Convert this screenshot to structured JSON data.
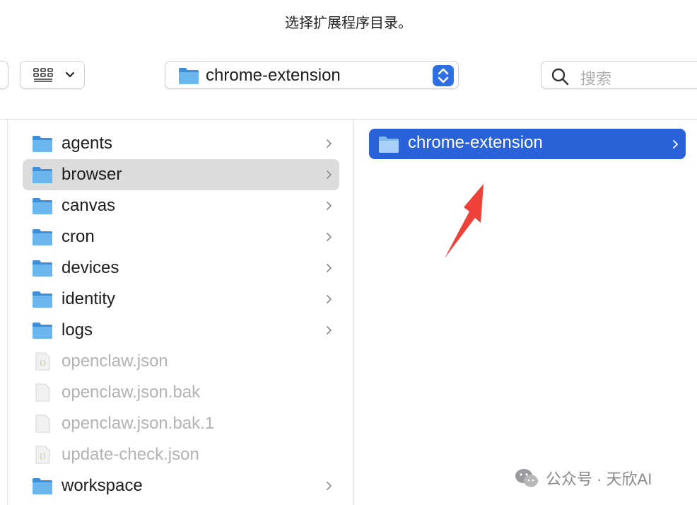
{
  "dialog": {
    "title": "选择扩展程序目录。"
  },
  "toolbar": {
    "view_icon": "icon-grid",
    "path_select": {
      "value": "chrome-extension"
    },
    "search": {
      "placeholder": "搜索"
    }
  },
  "column1": {
    "items": [
      {
        "label": "agents",
        "kind": "folder",
        "has_children": true
      },
      {
        "label": "browser",
        "kind": "folder",
        "has_children": true,
        "selected": true
      },
      {
        "label": "canvas",
        "kind": "folder",
        "has_children": true
      },
      {
        "label": "cron",
        "kind": "folder",
        "has_children": true
      },
      {
        "label": "devices",
        "kind": "folder",
        "has_children": true
      },
      {
        "label": "identity",
        "kind": "folder",
        "has_children": true
      },
      {
        "label": "logs",
        "kind": "folder",
        "has_children": true
      },
      {
        "label": "openclaw.json",
        "kind": "json-file",
        "disabled": true
      },
      {
        "label": "openclaw.json.bak",
        "kind": "file",
        "disabled": true
      },
      {
        "label": "openclaw.json.bak.1",
        "kind": "file",
        "disabled": true
      },
      {
        "label": "update-check.json",
        "kind": "json-file",
        "disabled": true
      },
      {
        "label": "workspace",
        "kind": "folder",
        "has_children": true
      }
    ]
  },
  "column2": {
    "items": [
      {
        "label": "chrome-extension",
        "kind": "folder",
        "has_children": true,
        "highlighted": true
      }
    ]
  },
  "watermark": {
    "text": "公众号 · 天欣AI"
  },
  "colors": {
    "accent": "#2a63d9",
    "folder_blue": "#5aa9ea",
    "selection_gray": "#dcdcdc",
    "annotation_red": "#f0403a"
  }
}
